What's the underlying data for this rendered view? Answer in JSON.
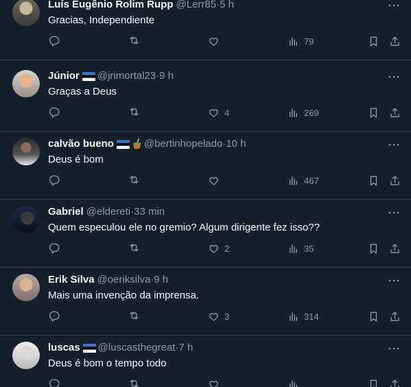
{
  "tweets": [
    {
      "name": "Luís Eugênio Rolim Rupp",
      "handle": "@Lerr85",
      "time": "5 h",
      "text": "Gracias, Independiente",
      "replies": "",
      "retweets": "",
      "likes": "",
      "views": "79",
      "flags": []
    },
    {
      "name": "Júnior",
      "handle": "@jrimortal23",
      "time": "9 h",
      "text": "Graças a Deus",
      "replies": "",
      "retweets": "",
      "likes": "4",
      "views": "269",
      "flags": [
        "estonia-flag-emoji"
      ]
    },
    {
      "name": "calvão bueno",
      "handle": "@bertinhopelado",
      "time": "10 h",
      "text": "Deus é bom",
      "replies": "",
      "retweets": "",
      "likes": "",
      "views": "467",
      "flags": [
        "estonia-flag-emoji",
        "mate-emoji"
      ]
    },
    {
      "name": "Gabriel",
      "handle": "@eldereti",
      "time": "33 min",
      "text": "Quem especulou ele no gremio? Algum dirigente fez isso??",
      "replies": "",
      "retweets": "",
      "likes": "2",
      "views": "35",
      "flags": []
    },
    {
      "name": "Erik Silva",
      "handle": "@oeriksilva",
      "time": "9 h",
      "text": "Mais uma invenção da imprensa.",
      "replies": "",
      "retweets": "",
      "likes": "3",
      "views": "314",
      "flags": []
    },
    {
      "name": "luscas",
      "handle": "@luscasthegreat",
      "time": "7 h",
      "text": "Deus é bom o tempo todo",
      "replies": "",
      "retweets": "",
      "likes": "",
      "views": "",
      "flags": [
        "estonia-flag-emoji"
      ]
    }
  ],
  "separator": " · ",
  "colors": {
    "background": "#15202b",
    "muted": "#8b98a5",
    "text": "#f7f9f9",
    "divider": "#38444d"
  }
}
